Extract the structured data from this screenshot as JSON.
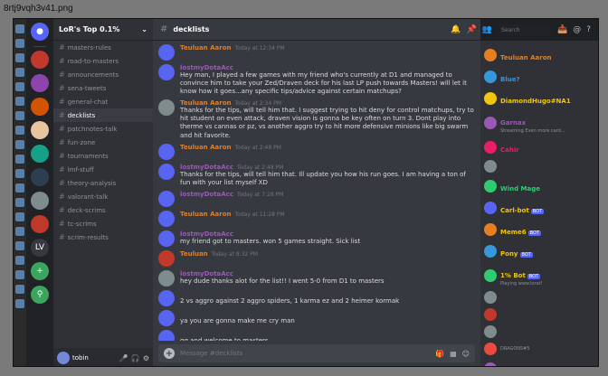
{
  "file_label": "8rtj9vqh3v41.png",
  "server": {
    "name": "LoR's Top 0.1%",
    "rail_items": [
      "LV"
    ]
  },
  "channels": [
    {
      "name": "masters-rules",
      "active": false
    },
    {
      "name": "road-to-masters",
      "active": false
    },
    {
      "name": "announcements",
      "active": false
    },
    {
      "name": "sena-tweets",
      "active": false
    },
    {
      "name": "general-chat",
      "active": false
    },
    {
      "name": "decklists",
      "active": true
    },
    {
      "name": "patchnotes-talk",
      "active": false
    },
    {
      "name": "fun-zone",
      "active": false
    },
    {
      "name": "tournaments",
      "active": false
    },
    {
      "name": "lmf-stuff",
      "active": false
    },
    {
      "name": "theory-analysis",
      "active": false
    },
    {
      "name": "valorant-talk",
      "active": false
    },
    {
      "name": "deck-scrims",
      "active": false
    },
    {
      "name": "tc-scrims",
      "active": false
    },
    {
      "name": "scrim-results",
      "active": false
    }
  ],
  "user": {
    "name": "tobin"
  },
  "channel_header": {
    "name": "decklists"
  },
  "search": {
    "placeholder": "Search"
  },
  "messages": [
    {
      "author": "Teuluan Aaron",
      "author_color": "#e67e22",
      "time": "Today at 12:34 PM",
      "text": "",
      "avatar_color": "#5865f2"
    },
    {
      "author": "lostmyDotaAcc",
      "author_color": "#9b59b6",
      "time": "",
      "text": "Hey man, I played a few games with my friend who's currently at D1 and managed to convince him to take your Zed/Draven deck for his last LP push towards Masters! will let it know how it goes...any specific tips/advice against certain matchups?",
      "avatar_color": "#5865f2"
    },
    {
      "author": "Teuluan Aaron",
      "author_color": "#e67e22",
      "time": "Today at 2:34 PM",
      "text": "Thanks for the tips, will tell him that. I suggest trying to hit deny for control matchups, try to hit student on even attack, draven vision is gonna be key often on turn 3. Dont play into therme vs cannas or pz, vs another aggro try to hit more defensive minions like big swarm and hit favorite.",
      "avatar_color": "#7f8c8d"
    },
    {
      "author": "Teuluan Aaron",
      "author_color": "#e67e22",
      "time": "Today at 2:48 PM",
      "text": "",
      "avatar_color": "#5865f2"
    },
    {
      "author": "lostmyDotaAcc",
      "author_color": "#9b59b6",
      "time": "Today at 2:48 PM",
      "text": "Thanks for the tips, will tell him that. Ill update you how his run goes. I am having a ton of fun with your list myself XD",
      "avatar_color": "#5865f2"
    },
    {
      "author": "lostmyDotaAcc",
      "author_color": "#9b59b6",
      "time": "Today at 7:28 PM",
      "text": "",
      "avatar_color": "#5865f2"
    },
    {
      "author": "Teuluan Aaron",
      "author_color": "#e67e22",
      "time": "Today at 11:28 PM",
      "text": "",
      "avatar_color": "#5865f2"
    },
    {
      "author": "lostmyDotaAcc",
      "author_color": "#9b59b6",
      "time": "",
      "text": "my friend got to masters. won 5 games straight. Sick list",
      "avatar_color": "#5865f2"
    },
    {
      "author": "Teuluan",
      "author_color": "#e67e22",
      "time": "Today at 8:32 PM",
      "text": "",
      "avatar_color": "#c0392b"
    },
    {
      "author": "lostmyDotaAcc",
      "author_color": "#9b59b6",
      "time": "",
      "text": "hey dude thanks alot for the list!! I went 5-0 from D1 to masters",
      "avatar_color": "#7f8c8d"
    },
    {
      "author": "",
      "author_color": "#dcddde",
      "time": "",
      "text": "2 vs aggro against 2 aggro spiders, 1 karma ez and 2 heimer kormak",
      "avatar_color": "#5865f2"
    },
    {
      "author": "",
      "author_color": "#dcddde",
      "time": "",
      "text": "ya you are gonna make me cry man",
      "avatar_color": "#5865f2"
    },
    {
      "author": "",
      "author_color": "#dcddde",
      "time": "",
      "text": "gg and welcome to masters",
      "avatar_color": "#5865f2"
    }
  ],
  "composer": {
    "placeholder": "Message #decklists"
  },
  "members": [
    {
      "name": "Teuluan Aaron",
      "status": "",
      "color": "#e67e22",
      "avatar": "#e67e22"
    },
    {
      "name": "Blue?",
      "status": "",
      "color": "#3498db",
      "avatar": "#3498db"
    },
    {
      "name": "DiamondHugo#NA1",
      "status": "",
      "color": "#f1c40f",
      "avatar": "#f1c40f"
    },
    {
      "name": "Garnax",
      "status": "Streaming Even more card...",
      "color": "#9b59b6",
      "avatar": "#9b59b6"
    },
    {
      "name": "Cahir",
      "status": "",
      "color": "#e91e63",
      "avatar": "#e91e63"
    },
    {
      "name": "",
      "status": "",
      "color": "#dcddde",
      "avatar": "#7f8c8d"
    },
    {
      "name": "Wind Mage",
      "status": "",
      "color": "#2ecc71",
      "avatar": "#2ecc71"
    },
    {
      "name": "Carl-bot",
      "status": "",
      "color": "#f1c40f",
      "avatar": "#5865f2",
      "tag": "BOT"
    },
    {
      "name": "Meme6",
      "status": "",
      "color": "#f1c40f",
      "avatar": "#e67e22",
      "tag": "BOT"
    },
    {
      "name": "Pony",
      "status": "",
      "color": "#f1c40f",
      "avatar": "#3498db",
      "tag": "BOT"
    },
    {
      "name": "1% Bot",
      "status": "Playing www.lorat!",
      "color": "#f1c40f",
      "avatar": "#2ecc71",
      "tag": "BOT"
    },
    {
      "name": "",
      "status": "",
      "color": "#dcddde",
      "avatar": "#7f8c8d"
    },
    {
      "name": "",
      "status": "",
      "color": "#dcddde",
      "avatar": "#c0392b"
    },
    {
      "name": "",
      "status": "",
      "color": "#dcddde",
      "avatar": "#7f8c8d"
    },
    {
      "name": "",
      "status": "DRAGONS#5",
      "color": "#dcddde",
      "avatar": "#e74c3c"
    },
    {
      "name": "Sora Shinzoku",
      "status": "",
      "color": "#9b59b6",
      "avatar": "#9b59b6"
    }
  ]
}
